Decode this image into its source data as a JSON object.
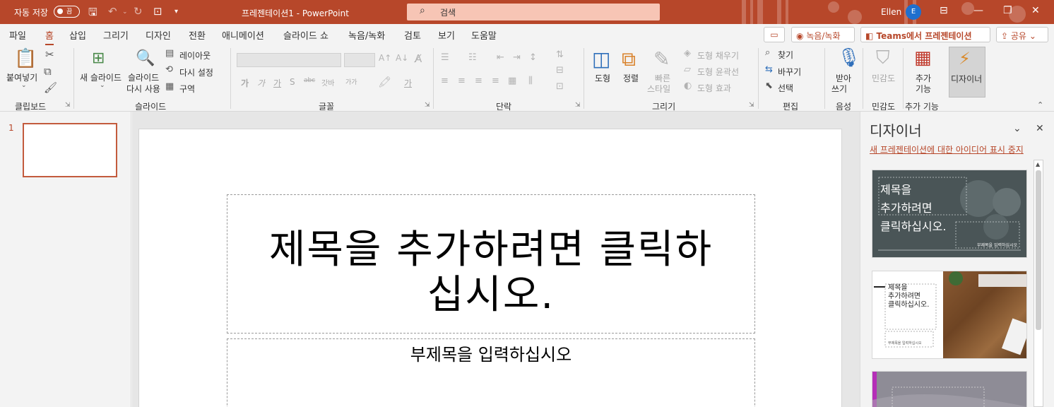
{
  "titlebar": {
    "autosave_label": "자동 저장",
    "autosave_state": "끔",
    "doc_title": "프레젠테이션1  -  PowerPoint",
    "search_placeholder": "검색",
    "user_name": "Ellen",
    "user_initial": "E",
    "accent_color": "#b7472a"
  },
  "tabs": [
    "파일",
    "홈",
    "삽입",
    "그리기",
    "디자인",
    "전환",
    "애니메이션",
    "슬라이드 쇼",
    "녹음/녹화",
    "검토",
    "보기",
    "도움말"
  ],
  "active_tab": "홈",
  "tab_actions": {
    "record": "녹음/녹화",
    "teams": "Teams에서 프레젠테이션",
    "share": "공유"
  },
  "ribbon": {
    "clipboard": {
      "paste": "붙여넣기",
      "group": "클립보드"
    },
    "slides": {
      "new_slide": "새 슬라이드",
      "reuse_1": "슬라이드",
      "reuse_2": "다시 사용",
      "layout": "레이아웃",
      "reset": "다시 설정",
      "section": "구역",
      "group": "슬라이드"
    },
    "font": {
      "group": "글꼴",
      "fmt_bold": "가",
      "fmt_italic": "가",
      "fmt_underline": "가",
      "fmt_strike": "S",
      "fmt_strike2": "abc",
      "fmt_spacing": "갓바",
      "fmt_case": "가가",
      "fmt_color": "가"
    },
    "paragraph": {
      "group": "단락"
    },
    "drawing": {
      "shape": "도형",
      "arrange": "정렬",
      "quick_1": "빠른",
      "quick_2": "스타일",
      "fill": "도형 채우기",
      "outline": "도형 윤곽선",
      "effect": "도형 효과",
      "group": "그리기"
    },
    "editing": {
      "find": "찾기",
      "replace": "바꾸기",
      "select": "선택",
      "group": "편집"
    },
    "voice": {
      "dictate_1": "받아",
      "dictate_2": "쓰기",
      "group": "음성"
    },
    "sensitivity": {
      "label": "민감도",
      "group": "민감도"
    },
    "addins": {
      "label_1": "추가",
      "label_2": "기능",
      "group": "추가 기능"
    },
    "designer": {
      "label": "디자이너"
    }
  },
  "thumbnails": [
    {
      "number": "1"
    }
  ],
  "slide": {
    "title_line1": "제목을 추가하려면 클릭하",
    "title_line2": "십시오.",
    "subtitle": "부제목을 입력하십시오"
  },
  "designer_pane": {
    "title": "디자이너",
    "stop_link": "새 프레젠테이션에 대한 아이디어 표시 중지",
    "card1_line1": "제목을",
    "card1_line2": "추가하려면",
    "card1_line3": "클릭하십시오.",
    "card1_sub": "부제목을 입력하십시오",
    "card2_line1": "제목을",
    "card2_line2": "추가하려면",
    "card2_line3": "클릭하십시오.",
    "card2_sub": "부제목을 입력하십시오"
  }
}
